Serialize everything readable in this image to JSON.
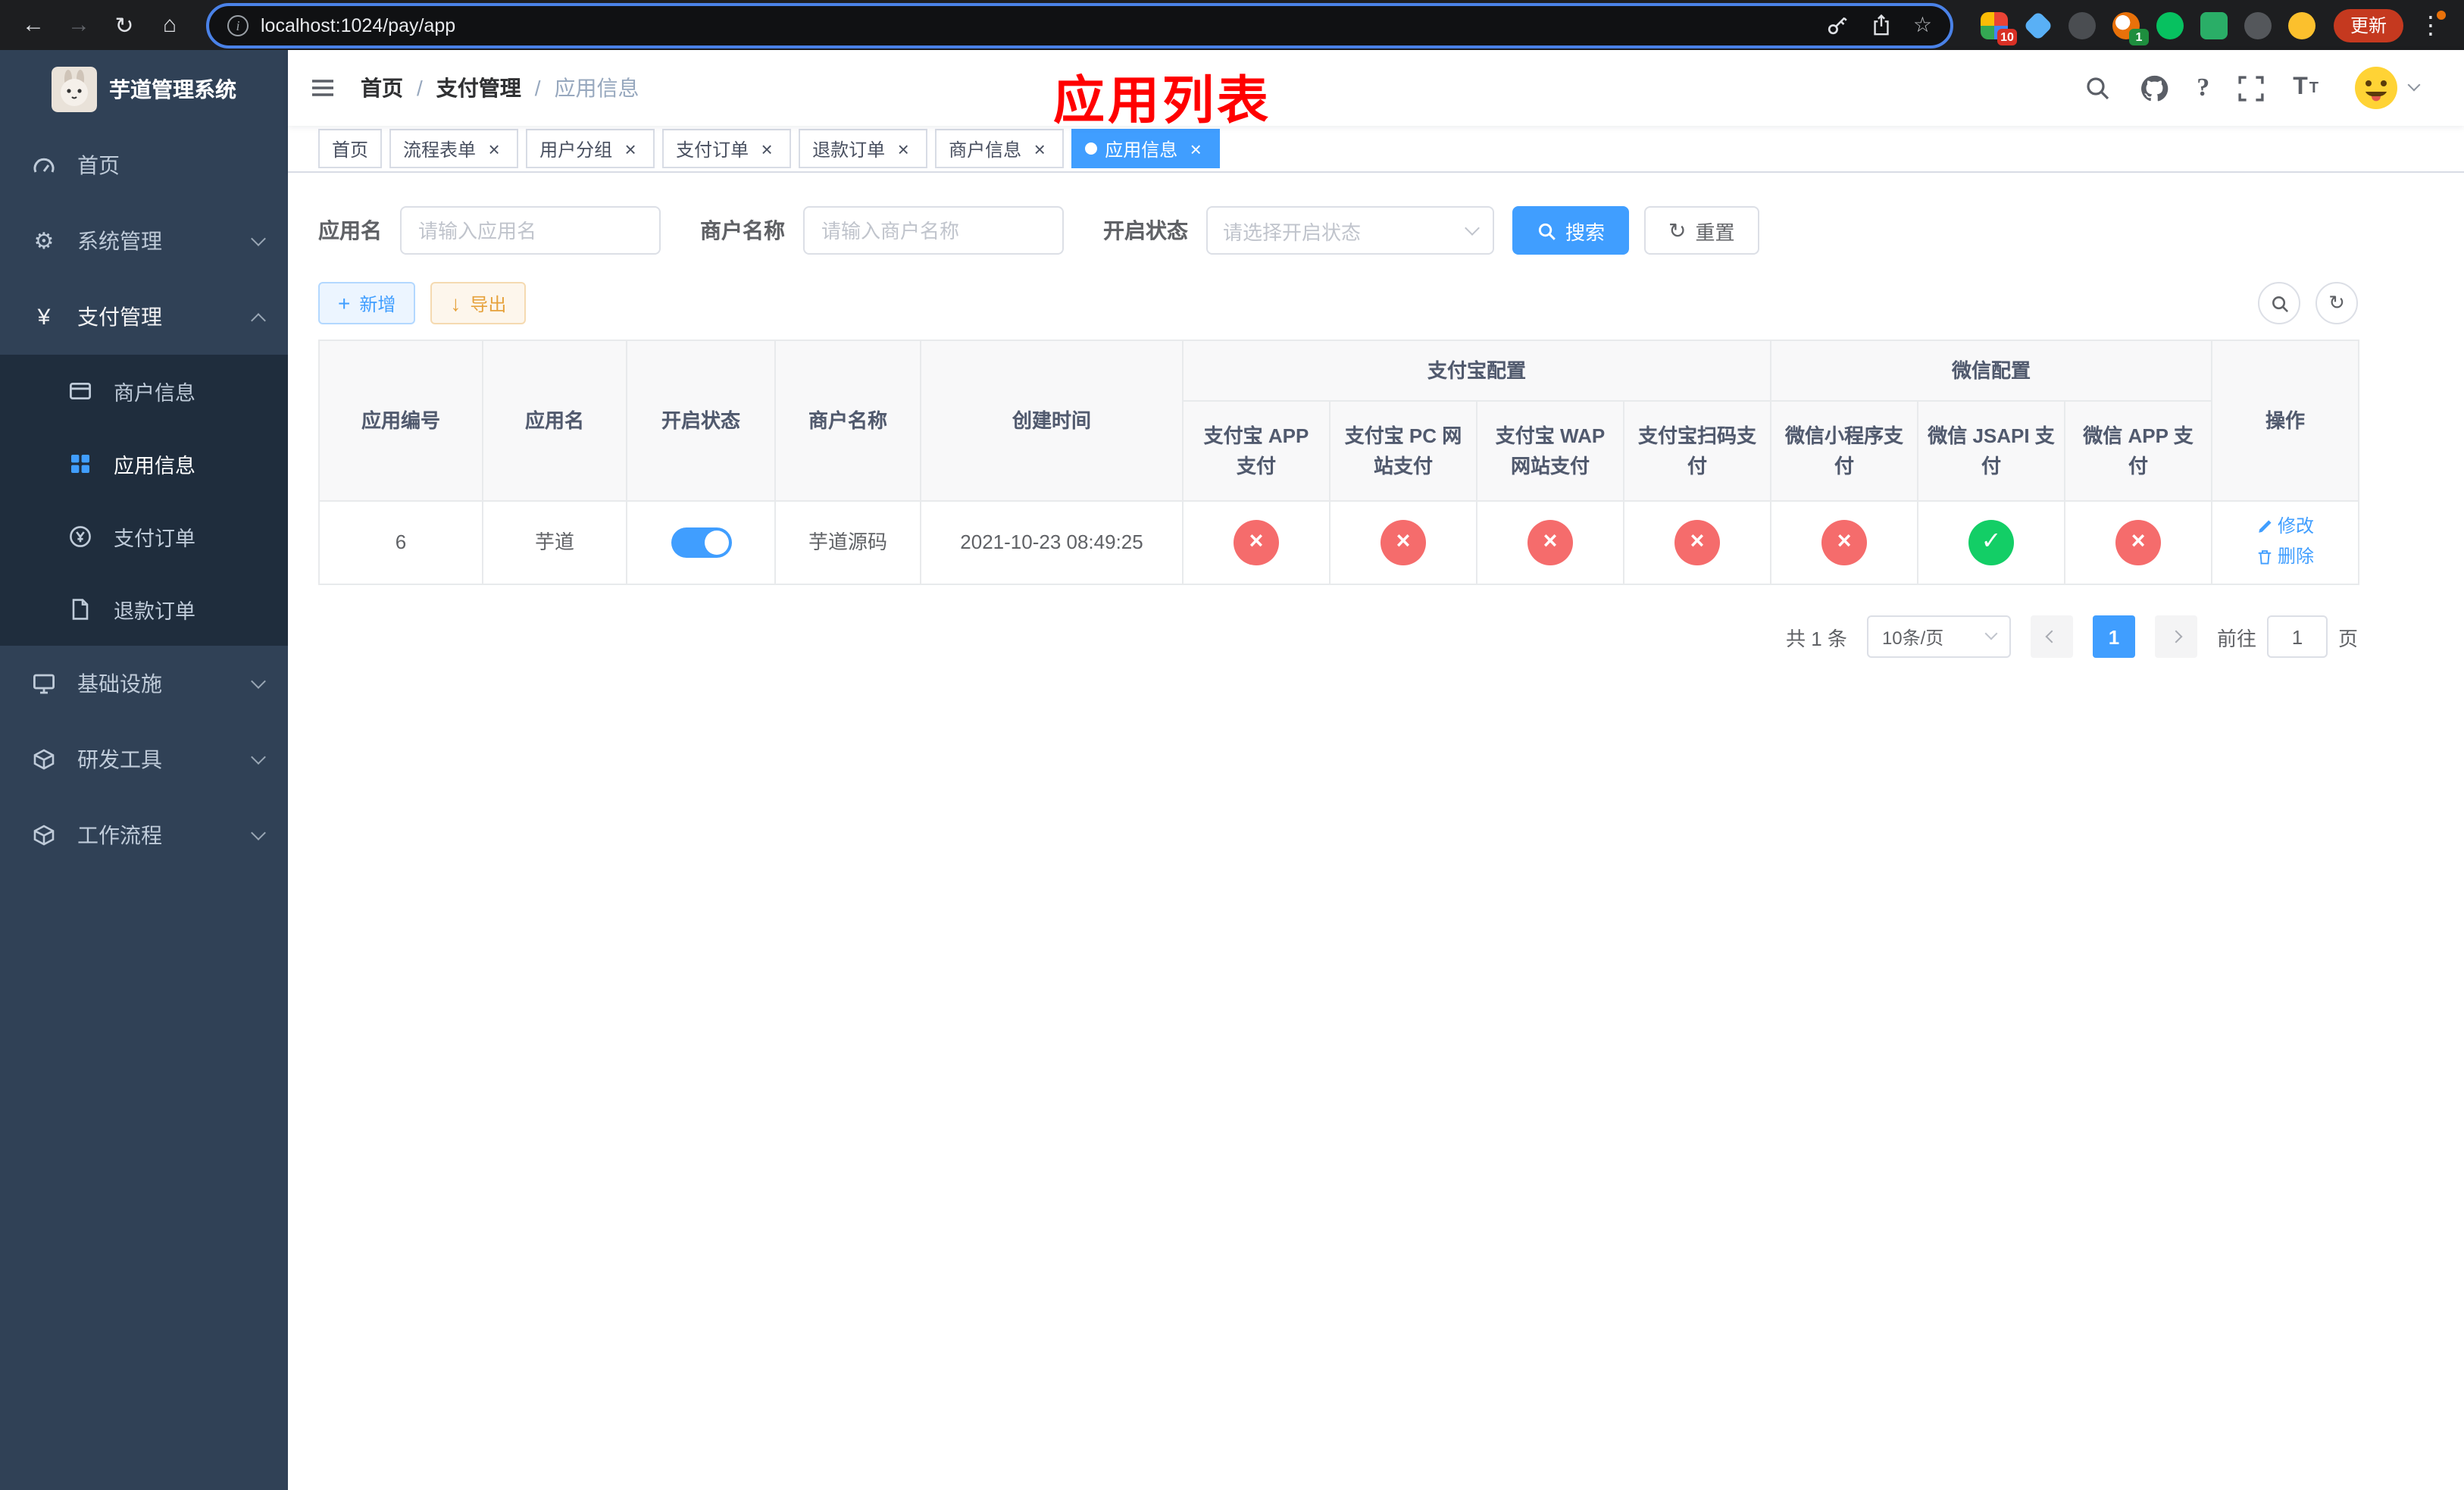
{
  "colors": {
    "primary": "#409eff",
    "success": "#13ce66",
    "danger": "#f56c6c",
    "warning": "#e6a23c",
    "annotation_red": "#ff0000",
    "sidebar_bg": "#304156",
    "submenu_bg": "#1f2d3d"
  },
  "icons": {
    "back": "←",
    "forward": "→",
    "reload": "↻",
    "home": "⌂",
    "info": "i",
    "star": "☆",
    "dots": "⋮",
    "gear": "⚙",
    "yen": "¥",
    "question": "?",
    "letter_T_big": "T",
    "letter_T_small": "T",
    "close": "×",
    "cross": "×",
    "check": "✓",
    "plus": "+",
    "download": "↓",
    "slash": "/"
  },
  "browser": {
    "url": "localhost:1024/pay/app",
    "update_button": "更新",
    "extension_badge_1": "10",
    "extension_badge_2": "1"
  },
  "sidebar": {
    "title": "芋道管理系统",
    "items": [
      {
        "label": "首页"
      },
      {
        "label": "系统管理"
      },
      {
        "label": "支付管理"
      },
      {
        "label": "基础设施"
      },
      {
        "label": "研发工具"
      },
      {
        "label": "工作流程"
      }
    ],
    "payment_children": [
      {
        "label": "商户信息"
      },
      {
        "label": "应用信息"
      },
      {
        "label": "支付订单"
      },
      {
        "label": "退款订单"
      }
    ]
  },
  "header": {
    "breadcrumb": [
      "首页",
      "支付管理",
      "应用信息"
    ],
    "annotation_title": "应用列表"
  },
  "tabs": [
    {
      "label": "首页",
      "closable": false,
      "active": false
    },
    {
      "label": "流程表单",
      "closable": true,
      "active": false
    },
    {
      "label": "用户分组",
      "closable": true,
      "active": false
    },
    {
      "label": "支付订单",
      "closable": true,
      "active": false
    },
    {
      "label": "退款订单",
      "closable": true,
      "active": false
    },
    {
      "label": "商户信息",
      "closable": true,
      "active": false
    },
    {
      "label": "应用信息",
      "closable": true,
      "active": true
    }
  ],
  "filters": {
    "app_name_label": "应用名",
    "app_name_placeholder": "请输入应用名",
    "merchant_label": "商户名称",
    "merchant_placeholder": "请输入商户名称",
    "status_label": "开启状态",
    "status_placeholder": "请选择开启状态",
    "search_button": "搜索",
    "reset_button": "重置"
  },
  "toolbar": {
    "add_button": "新增",
    "export_button": "导出"
  },
  "table": {
    "groups": {
      "alipay": "支付宝配置",
      "wechat": "微信配置"
    },
    "columns": [
      "应用编号",
      "应用名",
      "开启状态",
      "商户名称",
      "创建时间",
      "支付宝 APP 支付",
      "支付宝 PC 网站支付",
      "支付宝 WAP 网站支付",
      "支付宝扫码支付",
      "微信小程序支付",
      "微信 JSAPI 支付",
      "微信 APP 支付",
      "操作"
    ],
    "rows": [
      {
        "id": "6",
        "name": "芋道",
        "enabled": true,
        "merchant": "芋道源码",
        "created": "2021-10-23 08:49:25",
        "alipay_app": false,
        "alipay_pc": false,
        "alipay_wap": false,
        "alipay_qr": false,
        "wechat_mini": false,
        "wechat_jsapi": true,
        "wechat_app": false,
        "actions": [
          "修改",
          "删除"
        ]
      }
    ]
  },
  "pagination": {
    "total_text": "共 1 条",
    "page_size": "10条/页",
    "current_page": "1",
    "goto_label": "前往",
    "goto_value": "1",
    "goto_suffix": "页"
  }
}
